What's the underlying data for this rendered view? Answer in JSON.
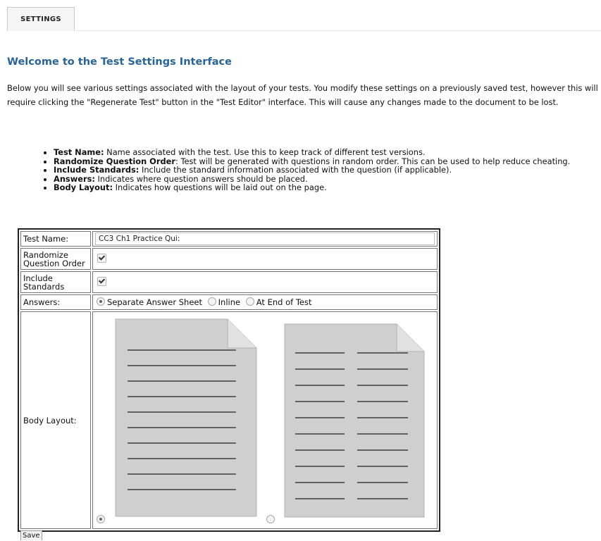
{
  "tabs": [
    {
      "label": "SETTINGS",
      "active": true
    }
  ],
  "page": {
    "title": "Welcome to the Test Settings Interface",
    "intro": "Below you will see various settings associated with the layout of your tests. You modify these settings on a previously saved test, however this will require clicking the \"Regenerate Test\" button in the \"Test Editor\" interface. This will cause any changes made to the document to be lost.",
    "features": [
      {
        "term": "Test Name:",
        "desc": " Name associated with the test. Use this to keep track of different test versions."
      },
      {
        "term": "Randomize Question Order",
        "desc": ": Test will be generated with questions in random order. This can be used to help reduce cheating."
      },
      {
        "term": "Include Standards:",
        "desc": " Include the standard information associated with the question (if applicable)."
      },
      {
        "term": "Answers:",
        "desc": " Indicates where question answers should be placed."
      },
      {
        "term": "Body Layout:",
        "desc": " Indicates how questions will be laid out on the page."
      }
    ]
  },
  "form": {
    "test_name": {
      "label": "Test Name:",
      "value": "CC3 Ch1 Practice Qui:"
    },
    "randomize": {
      "label": "Randomize Question Order",
      "checked": true
    },
    "standards": {
      "label": "Include Standards",
      "checked": true
    },
    "answers": {
      "label": "Answers:",
      "options": [
        "Separate Answer Sheet",
        "Inline",
        "At End of Test"
      ],
      "selected": "Separate Answer Sheet"
    },
    "body_layout": {
      "label": "Body Layout:",
      "options": [
        "single-column",
        "two-column"
      ],
      "selected": "single-column"
    },
    "save_label": "Save"
  },
  "colors": {
    "title": "#2a6496",
    "page_icon_fill": "#cfcfcf",
    "page_icon_stroke": "#b3b3b3",
    "rule_lines": "#222222"
  }
}
